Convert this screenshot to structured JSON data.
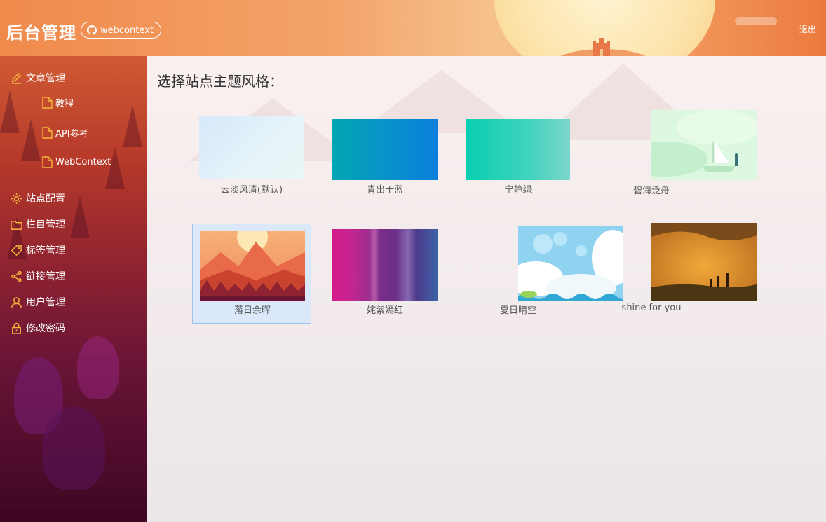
{
  "header": {
    "title": "后台管理",
    "github_label": "webcontext",
    "logout": "退出"
  },
  "sidebar": {
    "items": [
      {
        "label": "文章管理",
        "icon": "edit-icon"
      },
      {
        "label": "站点配置",
        "icon": "gear-icon"
      },
      {
        "label": "栏目管理",
        "icon": "folder-icon"
      },
      {
        "label": "标签管理",
        "icon": "tag-icon"
      },
      {
        "label": "链接管理",
        "icon": "share-icon"
      },
      {
        "label": "用户管理",
        "icon": "user-icon"
      },
      {
        "label": "修改密码",
        "icon": "lock-icon"
      }
    ],
    "subitems": [
      {
        "label": "教程",
        "icon": "file-icon"
      },
      {
        "label": "API参考",
        "icon": "file-icon"
      },
      {
        "label": "WebContext",
        "icon": "file-icon"
      }
    ],
    "accent_color": "#f6b73c"
  },
  "main": {
    "title": "选择站点主题风格：",
    "themes": [
      {
        "label": "云淡风清(默认)"
      },
      {
        "label": "青出于蓝"
      },
      {
        "label": "宁静绿"
      },
      {
        "label": "碧海泛舟"
      },
      {
        "label": "落日余晖",
        "selected": true
      },
      {
        "label": "姹紫嫣红"
      },
      {
        "label": "夏日晴空"
      },
      {
        "label": "shine for you"
      }
    ]
  }
}
